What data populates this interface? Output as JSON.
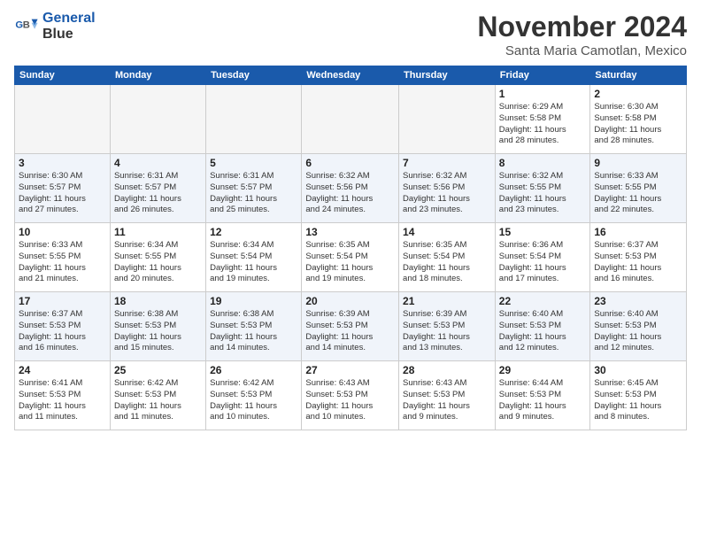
{
  "header": {
    "logo_line1": "General",
    "logo_line2": "Blue",
    "month": "November 2024",
    "location": "Santa Maria Camotlan, Mexico"
  },
  "weekdays": [
    "Sunday",
    "Monday",
    "Tuesday",
    "Wednesday",
    "Thursday",
    "Friday",
    "Saturday"
  ],
  "weeks": [
    [
      {
        "day": "",
        "info": ""
      },
      {
        "day": "",
        "info": ""
      },
      {
        "day": "",
        "info": ""
      },
      {
        "day": "",
        "info": ""
      },
      {
        "day": "",
        "info": ""
      },
      {
        "day": "1",
        "info": "Sunrise: 6:29 AM\nSunset: 5:58 PM\nDaylight: 11 hours\nand 28 minutes."
      },
      {
        "day": "2",
        "info": "Sunrise: 6:30 AM\nSunset: 5:58 PM\nDaylight: 11 hours\nand 28 minutes."
      }
    ],
    [
      {
        "day": "3",
        "info": "Sunrise: 6:30 AM\nSunset: 5:57 PM\nDaylight: 11 hours\nand 27 minutes."
      },
      {
        "day": "4",
        "info": "Sunrise: 6:31 AM\nSunset: 5:57 PM\nDaylight: 11 hours\nand 26 minutes."
      },
      {
        "day": "5",
        "info": "Sunrise: 6:31 AM\nSunset: 5:57 PM\nDaylight: 11 hours\nand 25 minutes."
      },
      {
        "day": "6",
        "info": "Sunrise: 6:32 AM\nSunset: 5:56 PM\nDaylight: 11 hours\nand 24 minutes."
      },
      {
        "day": "7",
        "info": "Sunrise: 6:32 AM\nSunset: 5:56 PM\nDaylight: 11 hours\nand 23 minutes."
      },
      {
        "day": "8",
        "info": "Sunrise: 6:32 AM\nSunset: 5:55 PM\nDaylight: 11 hours\nand 23 minutes."
      },
      {
        "day": "9",
        "info": "Sunrise: 6:33 AM\nSunset: 5:55 PM\nDaylight: 11 hours\nand 22 minutes."
      }
    ],
    [
      {
        "day": "10",
        "info": "Sunrise: 6:33 AM\nSunset: 5:55 PM\nDaylight: 11 hours\nand 21 minutes."
      },
      {
        "day": "11",
        "info": "Sunrise: 6:34 AM\nSunset: 5:55 PM\nDaylight: 11 hours\nand 20 minutes."
      },
      {
        "day": "12",
        "info": "Sunrise: 6:34 AM\nSunset: 5:54 PM\nDaylight: 11 hours\nand 19 minutes."
      },
      {
        "day": "13",
        "info": "Sunrise: 6:35 AM\nSunset: 5:54 PM\nDaylight: 11 hours\nand 19 minutes."
      },
      {
        "day": "14",
        "info": "Sunrise: 6:35 AM\nSunset: 5:54 PM\nDaylight: 11 hours\nand 18 minutes."
      },
      {
        "day": "15",
        "info": "Sunrise: 6:36 AM\nSunset: 5:54 PM\nDaylight: 11 hours\nand 17 minutes."
      },
      {
        "day": "16",
        "info": "Sunrise: 6:37 AM\nSunset: 5:53 PM\nDaylight: 11 hours\nand 16 minutes."
      }
    ],
    [
      {
        "day": "17",
        "info": "Sunrise: 6:37 AM\nSunset: 5:53 PM\nDaylight: 11 hours\nand 16 minutes."
      },
      {
        "day": "18",
        "info": "Sunrise: 6:38 AM\nSunset: 5:53 PM\nDaylight: 11 hours\nand 15 minutes."
      },
      {
        "day": "19",
        "info": "Sunrise: 6:38 AM\nSunset: 5:53 PM\nDaylight: 11 hours\nand 14 minutes."
      },
      {
        "day": "20",
        "info": "Sunrise: 6:39 AM\nSunset: 5:53 PM\nDaylight: 11 hours\nand 14 minutes."
      },
      {
        "day": "21",
        "info": "Sunrise: 6:39 AM\nSunset: 5:53 PM\nDaylight: 11 hours\nand 13 minutes."
      },
      {
        "day": "22",
        "info": "Sunrise: 6:40 AM\nSunset: 5:53 PM\nDaylight: 11 hours\nand 12 minutes."
      },
      {
        "day": "23",
        "info": "Sunrise: 6:40 AM\nSunset: 5:53 PM\nDaylight: 11 hours\nand 12 minutes."
      }
    ],
    [
      {
        "day": "24",
        "info": "Sunrise: 6:41 AM\nSunset: 5:53 PM\nDaylight: 11 hours\nand 11 minutes."
      },
      {
        "day": "25",
        "info": "Sunrise: 6:42 AM\nSunset: 5:53 PM\nDaylight: 11 hours\nand 11 minutes."
      },
      {
        "day": "26",
        "info": "Sunrise: 6:42 AM\nSunset: 5:53 PM\nDaylight: 11 hours\nand 10 minutes."
      },
      {
        "day": "27",
        "info": "Sunrise: 6:43 AM\nSunset: 5:53 PM\nDaylight: 11 hours\nand 10 minutes."
      },
      {
        "day": "28",
        "info": "Sunrise: 6:43 AM\nSunset: 5:53 PM\nDaylight: 11 hours\nand 9 minutes."
      },
      {
        "day": "29",
        "info": "Sunrise: 6:44 AM\nSunset: 5:53 PM\nDaylight: 11 hours\nand 9 minutes."
      },
      {
        "day": "30",
        "info": "Sunrise: 6:45 AM\nSunset: 5:53 PM\nDaylight: 11 hours\nand 8 minutes."
      }
    ]
  ],
  "colors": {
    "header_bg": "#1a5aab",
    "alt_row": "#eef2f9",
    "empty_bg": "#f5f5f5"
  }
}
